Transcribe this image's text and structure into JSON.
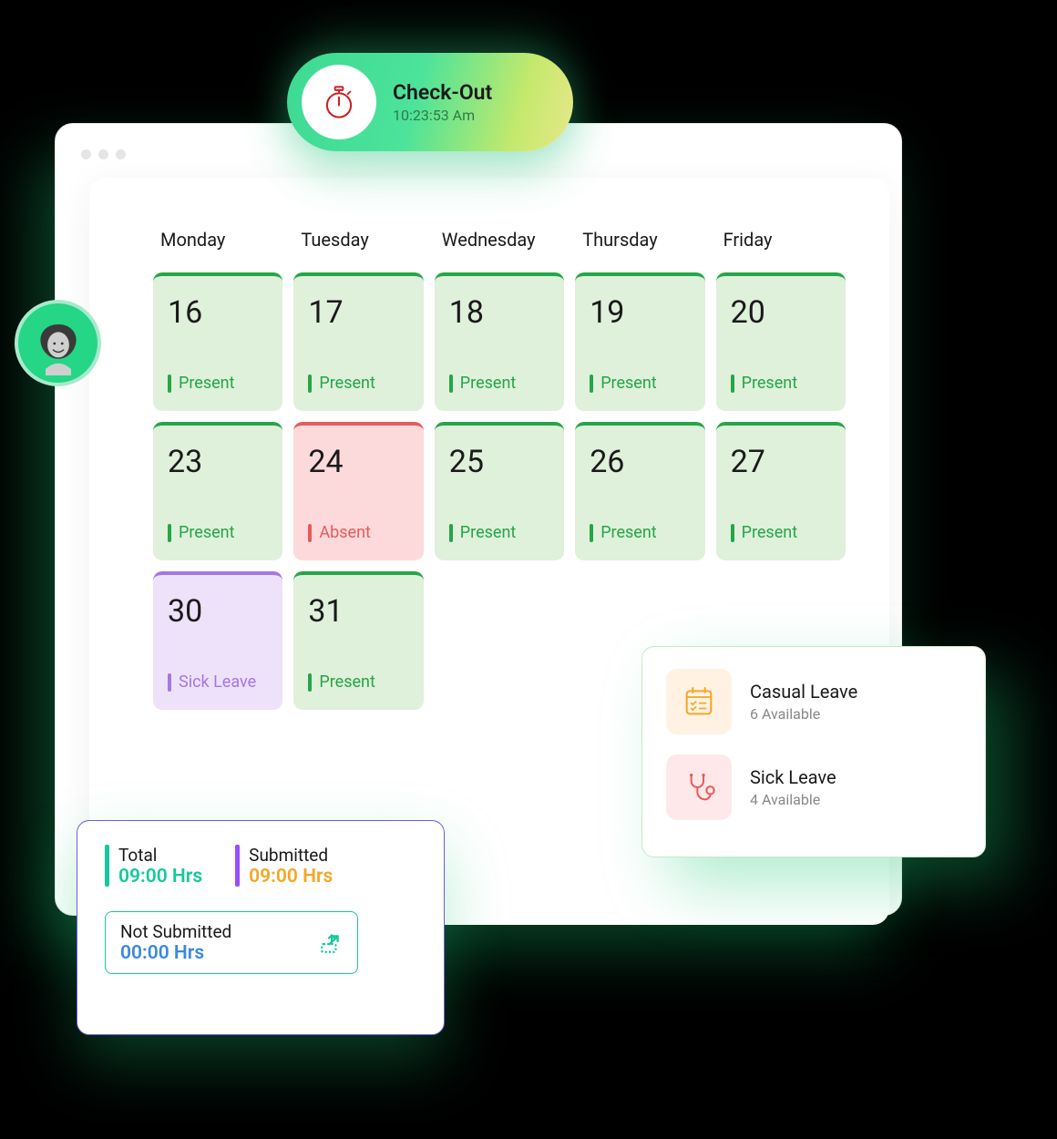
{
  "checkout": {
    "title": "Check-Out",
    "time": "10:23:53 Am"
  },
  "days": [
    "Monday",
    "Tuesday",
    "Wednesday",
    "Thursday",
    "Friday"
  ],
  "cells": [
    {
      "day": "16",
      "status": "Present",
      "kind": "present"
    },
    {
      "day": "17",
      "status": "Present",
      "kind": "present"
    },
    {
      "day": "18",
      "status": "Present",
      "kind": "present"
    },
    {
      "day": "19",
      "status": "Present",
      "kind": "present"
    },
    {
      "day": "20",
      "status": "Present",
      "kind": "present"
    },
    {
      "day": "23",
      "status": "Present",
      "kind": "present"
    },
    {
      "day": "24",
      "status": "Absent",
      "kind": "absent"
    },
    {
      "day": "25",
      "status": "Present",
      "kind": "present"
    },
    {
      "day": "26",
      "status": "Present",
      "kind": "present"
    },
    {
      "day": "27",
      "status": "Present",
      "kind": "present"
    },
    {
      "day": "30",
      "status": "Sick Leave",
      "kind": "sick"
    },
    {
      "day": "31",
      "status": "Present",
      "kind": "present"
    }
  ],
  "leaves": {
    "casual": {
      "title": "Casual Leave",
      "sub": "6 Available"
    },
    "sick": {
      "title": "Sick Leave",
      "sub": "4 Available"
    }
  },
  "hours": {
    "total": {
      "label": "Total",
      "value": "09:00 Hrs"
    },
    "submitted": {
      "label": "Submitted",
      "value": "09:00 Hrs"
    },
    "notSubmitted": {
      "label": "Not Submitted",
      "value": "00:00 Hrs"
    }
  },
  "colors": {
    "present": "#26a647",
    "absent": "#e85a5a",
    "sick": "#a675e8",
    "teal": "#16c99a",
    "orange": "#f5a623",
    "blue": "#3a8adc",
    "purple": "#9a4dff"
  }
}
